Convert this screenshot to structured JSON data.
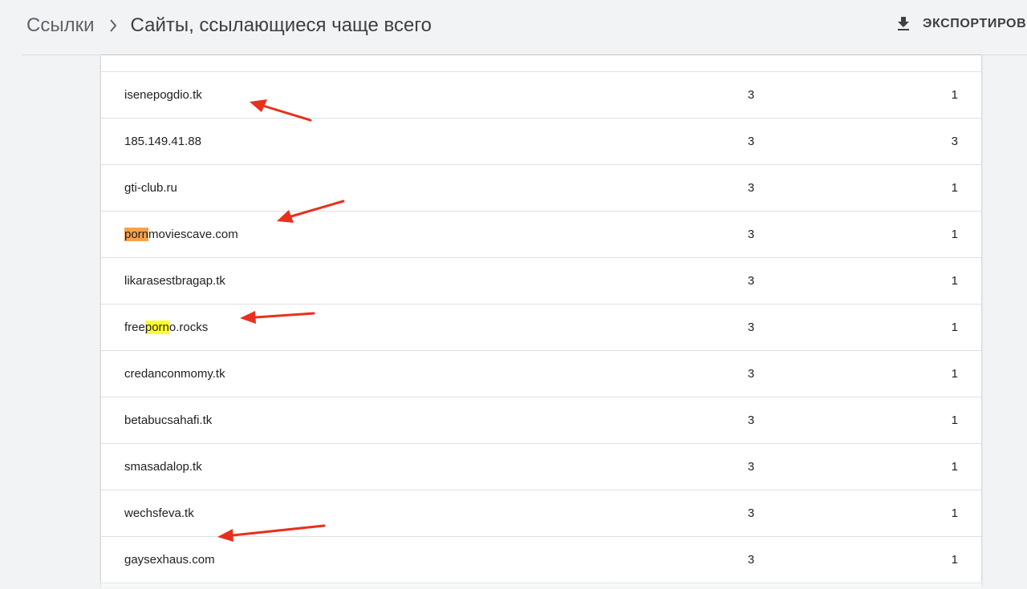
{
  "header": {
    "breadcrumb_parent": "Ссылки",
    "page_title": "Сайты, ссылающиеся чаще всего",
    "export_label": "ЭКСПОРТИРОВ",
    "export_icon": "download-icon",
    "separator_icon": "chevron-right-icon"
  },
  "table": {
    "rows": [
      {
        "domain": "isenepogdio.tk",
        "links": "3",
        "pages": "1"
      },
      {
        "domain": "185.149.41.88",
        "links": "3",
        "pages": "3"
      },
      {
        "domain": "gti-club.ru",
        "links": "3",
        "pages": "1"
      },
      {
        "domain_parts": [
          "porn",
          "moviescave.com"
        ],
        "links": "3",
        "pages": "1"
      },
      {
        "domain": "likarasestbragap.tk",
        "links": "3",
        "pages": "1"
      },
      {
        "domain_parts": [
          "free",
          "porn",
          "o.rocks"
        ],
        "links": "3",
        "pages": "1"
      },
      {
        "domain": "credanconmomy.tk",
        "links": "3",
        "pages": "1"
      },
      {
        "domain": "betabucsahafi.tk",
        "links": "3",
        "pages": "1"
      },
      {
        "domain": "smasadalop.tk",
        "links": "3",
        "pages": "1"
      },
      {
        "domain": "wechsfeva.tk",
        "links": "3",
        "pages": "1"
      },
      {
        "domain": "gaysexhaus.com",
        "links": "3",
        "pages": "1"
      }
    ]
  },
  "colors": {
    "annotation_arrow": "#e8301c",
    "highlight_orange": "#f6a24a",
    "highlight_yellow": "#ffff2e"
  }
}
